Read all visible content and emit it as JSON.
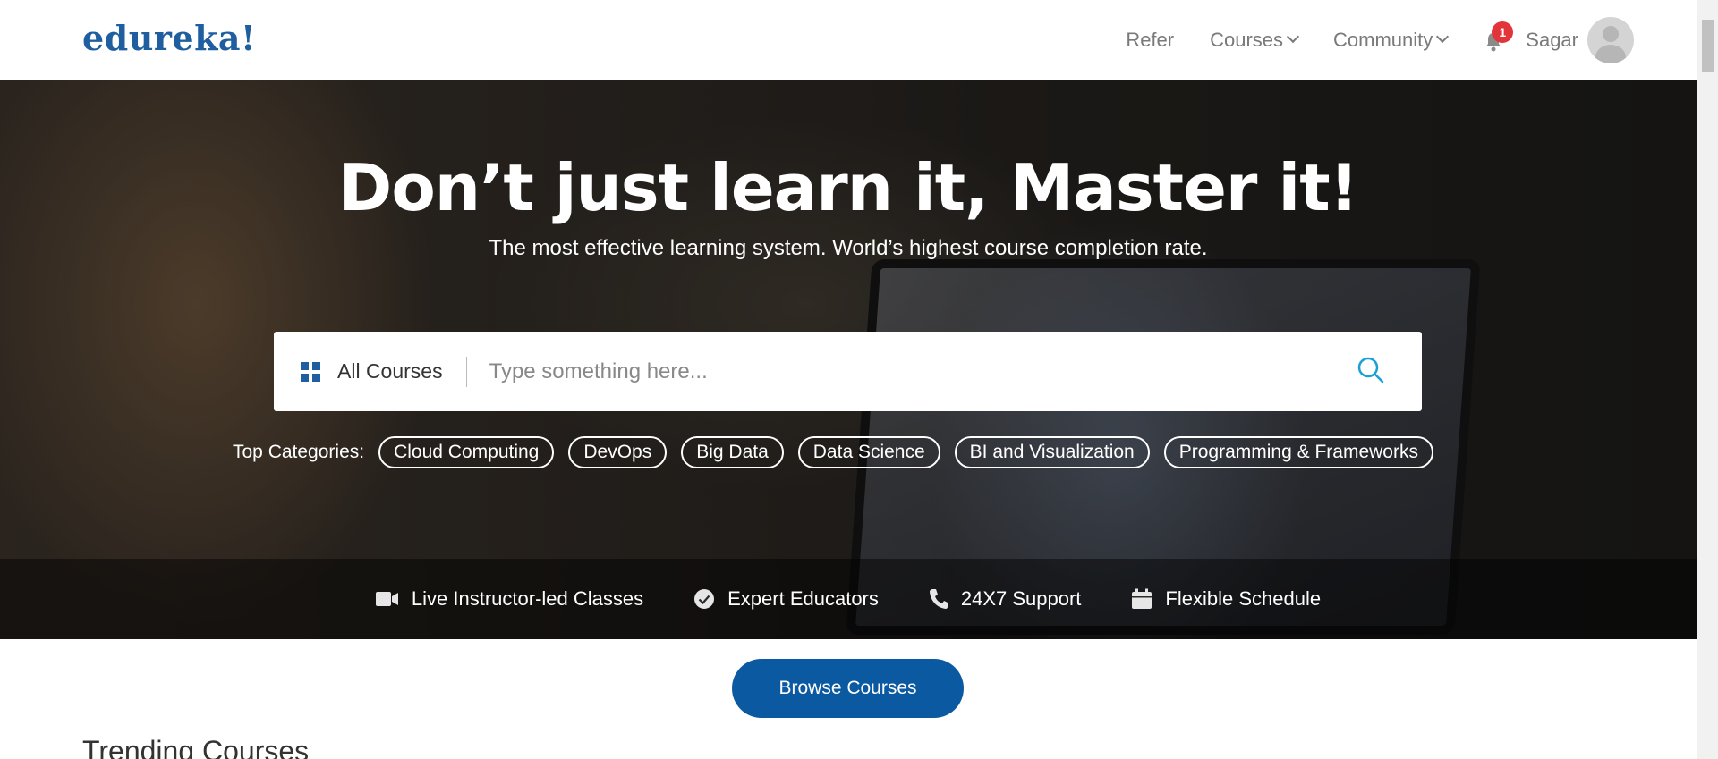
{
  "header": {
    "logo": "edureka!",
    "nav": {
      "refer": "Refer",
      "courses": "Courses",
      "community": "Community"
    },
    "notification_count": "1",
    "user_name": "Sagar"
  },
  "hero": {
    "title": "Don’t just learn it, Master it!",
    "subtitle": "The most effective learning system. World’s highest course completion rate.",
    "search": {
      "category": "All Courses",
      "placeholder": "Type something here..."
    },
    "categories_label": "Top Categories:",
    "categories": [
      "Cloud Computing",
      "DevOps",
      "Big Data",
      "Data Science",
      "BI and Visualization",
      "Programming & Frameworks"
    ],
    "features": [
      {
        "label": "Live Instructor-led Classes",
        "icon": "video-camera-icon"
      },
      {
        "label": "Expert Educators",
        "icon": "verified-badge-icon"
      },
      {
        "label": "24X7 Support",
        "icon": "phone-icon"
      },
      {
        "label": "Flexible Schedule",
        "icon": "calendar-icon"
      }
    ]
  },
  "browse_button": "Browse Courses",
  "trending_heading": "Trending Courses",
  "colors": {
    "brand_blue": "#1f5f9f",
    "button_blue": "#0b59a1",
    "badge_red": "#e2343a",
    "search_icon": "#1a9fd6"
  }
}
